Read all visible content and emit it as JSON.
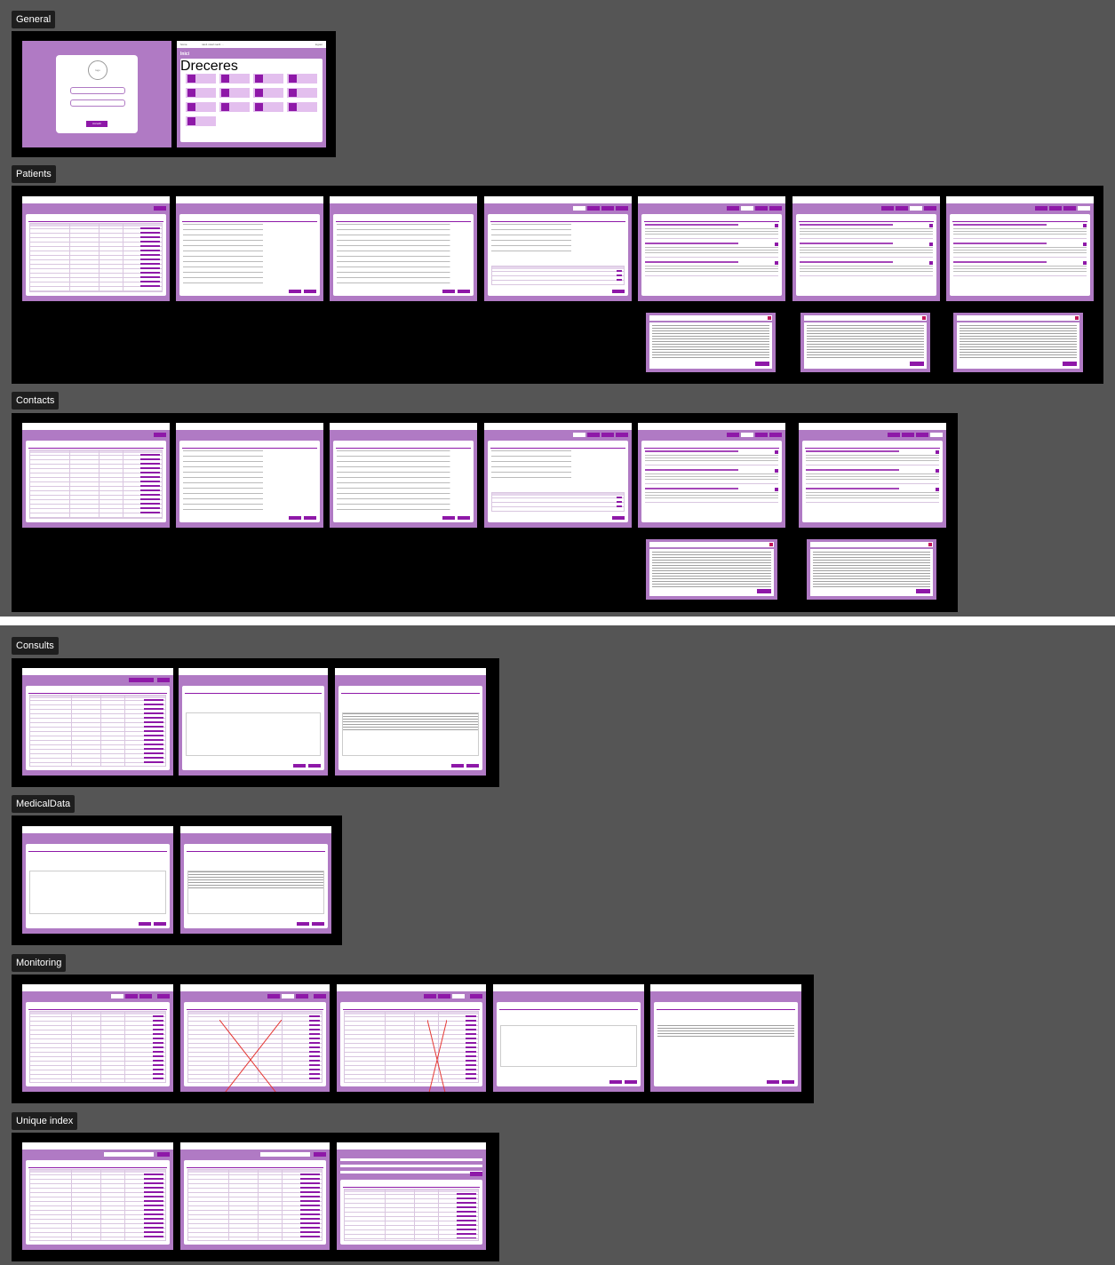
{
  "sections": {
    "general": "General",
    "patients": "Patients",
    "contacts": "Contacts",
    "consults": "Consults",
    "medical_data": "MedicalData",
    "monitoring": "Monitoring",
    "unique_index": "Unique index"
  },
  "login": {
    "avatar_label": "logo",
    "button_label": "Accedir"
  },
  "home": {
    "title": "Inici",
    "card_title": "Dreceres"
  },
  "colors": {
    "canvas": "#555555",
    "group_background": "#000000",
    "frame_purple": "#b07ac4",
    "accent_purple": "#8e18a8",
    "close_red": "#c2185b"
  }
}
